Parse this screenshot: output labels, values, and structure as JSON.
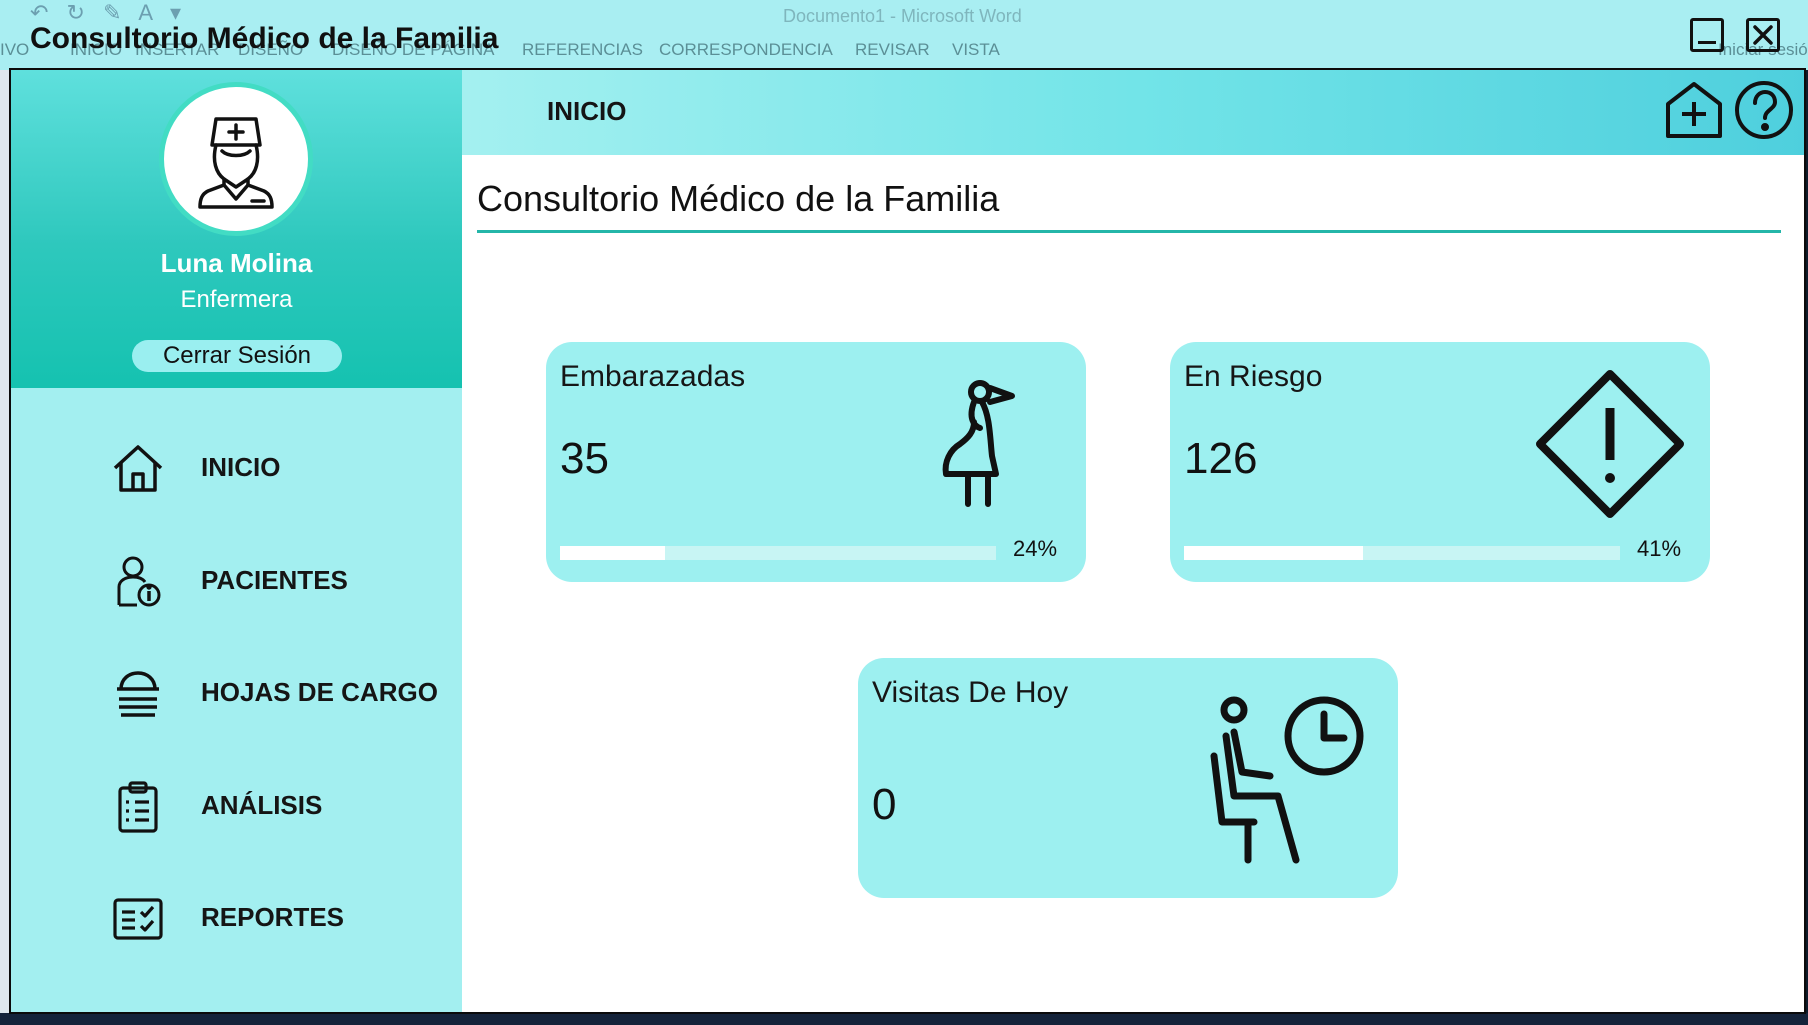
{
  "background_window": {
    "title": "Documento1 - Microsoft Word",
    "tabs": [
      "IVO",
      "INICIO",
      "INSERTAR",
      "DISEÑO",
      "DISEÑO DE PÁGINA",
      "REFERENCIAS",
      "CORRESPONDENCIA",
      "REVISAR",
      "VISTA"
    ],
    "right_text": "Iniciar sesió"
  },
  "app": {
    "title": "Consultorio Médico de la Familia",
    "minimize_icon": "minimize-icon",
    "close_icon": "close-icon"
  },
  "sidebar": {
    "profile": {
      "avatar_icon": "nurse-icon",
      "name": "Luna Molina",
      "role": "Enfermera",
      "logout_label": "Cerrar Sesión"
    },
    "items": [
      {
        "label": "INICIO",
        "icon": "home-icon"
      },
      {
        "label": "PACIENTES",
        "icon": "patient-info-icon"
      },
      {
        "label": "HOJAS DE CARGO",
        "icon": "stack-icon"
      },
      {
        "label": "ANÁLISIS",
        "icon": "clipboard-icon"
      },
      {
        "label": "REPORTES",
        "icon": "checklist-icon"
      }
    ]
  },
  "topbar": {
    "breadcrumb": "INICIO",
    "add_icon": "add-home-icon",
    "help_icon": "help-icon"
  },
  "main": {
    "title": "Consultorio Médico de la Familia",
    "cards": [
      {
        "title": "Embarazadas",
        "value": "35",
        "percent_label": "24%",
        "progress": 0.24,
        "icon": "pregnant-woman-icon"
      },
      {
        "title": "En Riesgo",
        "value": "126",
        "percent_label": "41%",
        "progress": 0.41,
        "icon": "warning-diamond-icon"
      },
      {
        "title": "Visitas De Hoy",
        "value": "0",
        "icon": "waiting-room-icon"
      }
    ]
  },
  "colors": {
    "sidebar_bg": "#a3eff0",
    "profile_gradient_bottom": "#15c2b0",
    "card_bg": "#9df0f0",
    "accent_line": "#24b6a9"
  }
}
